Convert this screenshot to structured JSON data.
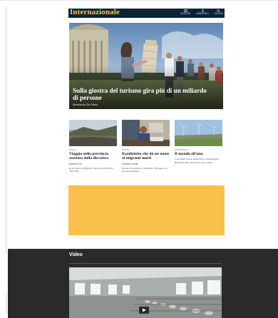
{
  "header": {
    "logo": "Internazionale",
    "icons": [
      {
        "name": "sections-icon",
        "label": "SEZIONI"
      },
      {
        "name": "account-icon",
        "label": "ABBONATI"
      },
      {
        "name": "search-icon",
        "label": "CERCA"
      }
    ]
  },
  "hero": {
    "title": "Sulla giostra del turismo gira più di un miliardo di persone",
    "author": "Alessandro De Vanto"
  },
  "cards": [
    {
      "kicker": "ITALIA",
      "title": "Viaggio nella provincia assetata dalla discarica",
      "author": "Martina Forti",
      "desc": "In provincia di Brescia. Mercurio di Brescia della Sala"
    },
    {
      "kicker": "ITALIA",
      "title": "Il poliziotto che dà un nome ai migranti morti",
      "author": "Annalisa Camilli",
      "desc": "Donato Zuccheri ha cominciato. Bologna e le persone annegate"
    },
    {
      "kicker": "ECONOMIA",
      "title": "Il mondo all’una",
      "author": "",
      "desc": "Cancellieri Sposi, Repubblica Centrafricana. British donano una nuova terra tessile"
    }
  ],
  "video": {
    "title": "Video"
  },
  "colors": {
    "header_bg": "#0c2438",
    "logo": "#f2c94c",
    "ad_bg": "#fbc04b",
    "video_bg": "#2a2a2a"
  }
}
